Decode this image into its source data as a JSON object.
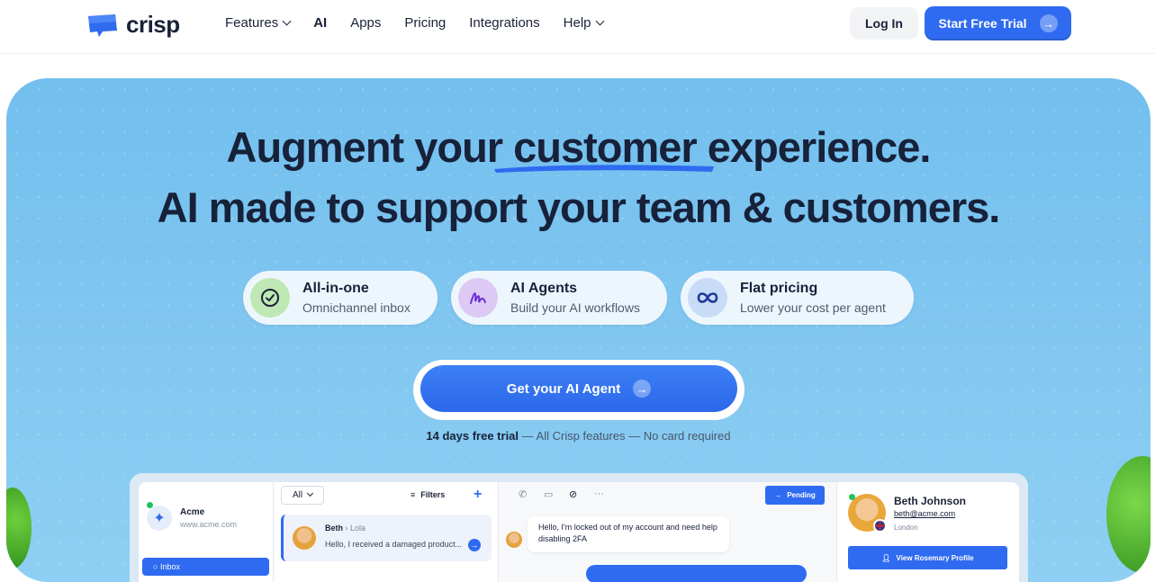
{
  "brand": {
    "name": "crisp",
    "accent": "#2f6bf0"
  },
  "nav": {
    "links": [
      {
        "label": "Features",
        "dropdown": true
      },
      {
        "label": "AI",
        "dropdown": false
      },
      {
        "label": "Apps",
        "dropdown": false
      },
      {
        "label": "Pricing",
        "dropdown": false
      },
      {
        "label": "Integrations",
        "dropdown": false
      },
      {
        "label": "Help",
        "dropdown": true
      }
    ],
    "login_label": "Log In",
    "trial_label": "Start Free Trial"
  },
  "hero": {
    "headline_part1": "Augment your ",
    "headline_highlight": "customer",
    "headline_part2": " experience.",
    "headline_line2": "AI made to support your team & customers.",
    "features": [
      {
        "title": "All-in-one",
        "subtitle": "Omnichannel inbox",
        "icon": "check-circle-icon"
      },
      {
        "title": "AI Agents",
        "subtitle": "Build your AI workflows",
        "icon": "squiggle-icon"
      },
      {
        "title": "Flat pricing",
        "subtitle": "Lower your cost per agent",
        "icon": "infinity-icon"
      }
    ],
    "cta_label": "Get your AI Agent",
    "trial_bold": "14 days free trial",
    "trial_rest": " — All Crisp features — No card required"
  },
  "app_preview": {
    "workspace": {
      "name": "Acme",
      "url": "www.acme.com"
    },
    "inbox_label": "Inbox",
    "filter_all": "All",
    "filters_label": "Filters",
    "conversation": {
      "name": "Beth",
      "assignee": "Lola",
      "preview": "Hello, I received a damaged product..."
    },
    "pending_label": "Pending",
    "message": "Hello, I'm locked out of my account and need help disabling 2FA",
    "profile": {
      "name": "Beth Johnson",
      "email": "beth@acme.com",
      "city": "London",
      "button": "View Rosemary Profile"
    }
  }
}
